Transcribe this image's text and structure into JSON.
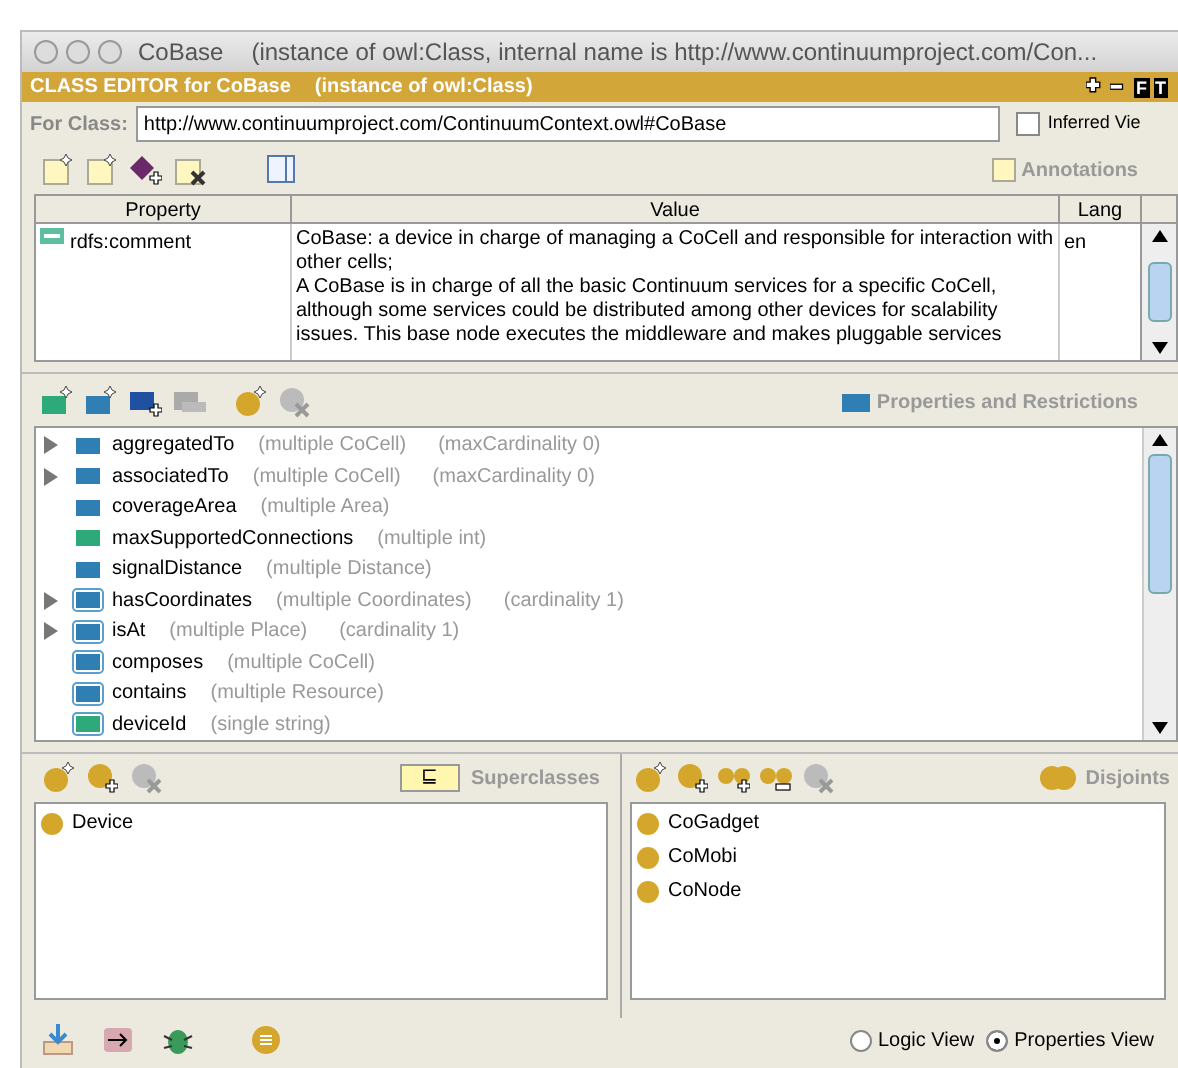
{
  "window": {
    "title": "CoBase",
    "subtitle": "(instance of owl:Class, internal name is http://www.continuumproject.com/Con..."
  },
  "editor": {
    "title": "CLASS EDITOR for CoBase",
    "subtitle": "(instance of owl:Class)",
    "header_buttons": [
      "F",
      "T"
    ]
  },
  "for_class": {
    "label": "For Class:",
    "value": "http://www.continuumproject.com/ContinuumContext.owl#CoBase",
    "inferred_view": {
      "label": "Inferred Vie",
      "checked": false
    }
  },
  "annotations": {
    "label": "Annotations",
    "columns": [
      "Property",
      "Value",
      "Lang"
    ],
    "rows": [
      {
        "property": "rdfs:comment",
        "value": [
          "CoBase: a device in charge of managing a CoCell and responsible for interaction with other cells;",
          "A CoBase is in charge of all the basic Continuum services for a specific CoCell, although some services could be distributed among other devices for scalability issues. This base node executes the middleware and makes pluggable services"
        ],
        "lang": "en"
      }
    ]
  },
  "properties": {
    "label": "Properties and Restrictions",
    "items": [
      {
        "name": "aggregatedTo",
        "type": "(multiple CoCell)",
        "restriction": "(maxCardinality 0)",
        "kind": "object",
        "inherited": false,
        "expandable": true
      },
      {
        "name": "associatedTo",
        "type": "(multiple CoCell)",
        "restriction": "(maxCardinality 0)",
        "kind": "object",
        "inherited": false,
        "expandable": true
      },
      {
        "name": "coverageArea",
        "type": "(multiple Area)",
        "kind": "object",
        "inherited": false,
        "expandable": false
      },
      {
        "name": "maxSupportedConnections",
        "type": "(multiple int)",
        "kind": "datatype",
        "inherited": false,
        "expandable": false
      },
      {
        "name": "signalDistance",
        "type": "(multiple Distance)",
        "kind": "object",
        "inherited": false,
        "expandable": false
      },
      {
        "name": "hasCoordinates",
        "type": "(multiple Coordinates)",
        "restriction": "(cardinality 1)",
        "kind": "object",
        "inherited": true,
        "expandable": true
      },
      {
        "name": "isAt",
        "type": "(multiple Place)",
        "restriction": "(cardinality 1)",
        "kind": "object",
        "inherited": true,
        "expandable": true
      },
      {
        "name": "composes",
        "type": "(multiple CoCell)",
        "kind": "object",
        "inherited": true,
        "expandable": false
      },
      {
        "name": "contains",
        "type": "(multiple Resource)",
        "kind": "object",
        "inherited": true,
        "expandable": false
      },
      {
        "name": "deviceId",
        "type": "(single string)",
        "kind": "datatype",
        "inherited": true,
        "expandable": false
      }
    ]
  },
  "superclasses": {
    "label": "Superclasses",
    "badge": "⊑",
    "items": [
      "Device"
    ]
  },
  "disjoints": {
    "label": "Disjoints",
    "items": [
      "CoGadget",
      "CoMobi",
      "CoNode"
    ]
  },
  "views": [
    {
      "label": "Logic View",
      "selected": false
    },
    {
      "label": "Properties View",
      "selected": true
    }
  ]
}
